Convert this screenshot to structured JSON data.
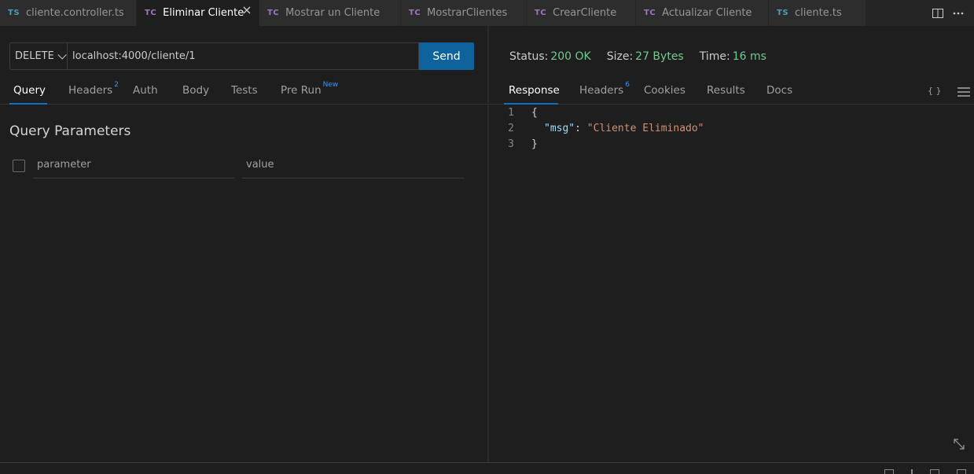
{
  "tabs": [
    {
      "type": "TS",
      "label": "cliente.controller.ts",
      "active": false
    },
    {
      "type": "TC",
      "label": "Eliminar Cliente",
      "active": true
    },
    {
      "type": "TC",
      "label": "Mostrar un Cliente",
      "active": false
    },
    {
      "type": "TC",
      "label": "MostrarClientes",
      "active": false
    },
    {
      "type": "TC",
      "label": "CrearCliente",
      "active": false
    },
    {
      "type": "TC",
      "label": "Actualizar Cliente",
      "active": false
    },
    {
      "type": "TS",
      "label": "cliente.ts",
      "active": false
    }
  ],
  "request": {
    "method": "DELETE",
    "url": "localhost:4000/cliente/1",
    "send_label": "Send"
  },
  "request_tabs": {
    "query": "Query",
    "headers": "Headers",
    "headers_count": "2",
    "auth": "Auth",
    "body": "Body",
    "tests": "Tests",
    "prerun": "Pre Run",
    "prerun_badge": "New"
  },
  "query_params": {
    "title": "Query Parameters",
    "parameter_placeholder": "parameter",
    "value_placeholder": "value"
  },
  "response_status": {
    "status_label": "Status:",
    "status_value": "200 OK",
    "size_label": "Size:",
    "size_value": "27 Bytes",
    "time_label": "Time:",
    "time_value": "16 ms"
  },
  "response_tabs": {
    "response": "Response",
    "headers": "Headers",
    "headers_count": "6",
    "cookies": "Cookies",
    "results": "Results",
    "docs": "Docs",
    "format_icon": "{ }"
  },
  "response_body": {
    "line1_num": "1",
    "line2_num": "2",
    "line3_num": "3",
    "open_brace": "{",
    "key": "\"msg\"",
    "colon": ": ",
    "value": "\"Cliente Eliminado\"",
    "close_brace": "}"
  },
  "colors": {
    "accent": "#0e639c",
    "success": "#73c991",
    "ts_icon": "#519aba",
    "tc_icon": "#a074c4"
  }
}
